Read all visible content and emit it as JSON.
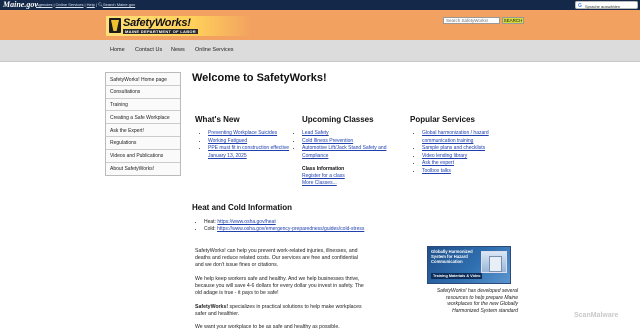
{
  "gov_bar": {
    "logo": "Maine.gov",
    "links": [
      "Agencies",
      "Online Services",
      "Help"
    ],
    "search_link": "Search Maine.gov"
  },
  "translate": {
    "label": "Sprache auswählen"
  },
  "header": {
    "logo_title": "SafetyWorks!",
    "logo_subtitle": "MAINE DEPARTMENT OF LABOR",
    "search_placeholder": "Search SafetyWorks!",
    "search_button": "SEARCH",
    "bg_color": "#f2a160"
  },
  "nav": {
    "items": [
      "Home",
      "Contact Us",
      "News",
      "Online Services"
    ]
  },
  "sidebar": {
    "items": [
      "SafetyWorks! Home page",
      "Consultations",
      "Training",
      "Creating a Safe Workplace",
      "Ask the Expert!",
      "Regulations",
      "Videos and Publications",
      "About SafetyWorks!"
    ]
  },
  "main": {
    "welcome": "Welcome to SafetyWorks!",
    "whats_new": {
      "title": "What's New",
      "items": [
        "Preventing Workplace Suicides",
        "Working Fatigued",
        "PPE must fit in construction effective January 13, 2025"
      ]
    },
    "upcoming": {
      "title": "Upcoming Classes",
      "items": [
        "Lead Safety",
        "Cold Illness Prevention",
        "Automotive Lift/Jack Stand Safety and Compliance"
      ],
      "class_info_title": "Class Information",
      "class_links": [
        "Register for a class",
        "More Classes..."
      ]
    },
    "popular": {
      "title": "Popular Services",
      "items": [
        "Global harmonization / hazard communication training",
        "Sample plans and checklists",
        "Video lending library",
        "Ask the expert",
        "Toolbox talks"
      ]
    },
    "heat_cold": {
      "title": "Heat and Cold Information",
      "heat_label": "Heat: ",
      "heat_url": "https://www.osha.gov/heat",
      "cold_label": "Cold: ",
      "cold_url": "https://www.osha.gov/emergency-preparedness/guides/cold-stress"
    },
    "para1": "SafetyWorks! can help you prevent work-related injuries, illnesses, and deaths and reduce related costs. Our services are free and confidential and we don't issue fines or citations.",
    "para2": "We help keep workers safe and healthy. And we help businesses thrive, because you will save 4-6 dollars for every dollar you invest in safety. The old adage is true - it pays to be safe!",
    "para3_bold": "SafetyWorks!",
    "para3": " specializes in practical solutions to help make workplaces safer and healthier.",
    "para4": "We want your workplace to be as safe and healthy as possible.",
    "promo": {
      "title": "Globally Harmonized System for Hazard Communication",
      "band": "Training Materials & Video",
      "caption": "SafetyWorks! has developed several resources to help prepare Maine workplaces for the new Globally Harmonized System standard"
    }
  },
  "watermark": "ScanMalware"
}
